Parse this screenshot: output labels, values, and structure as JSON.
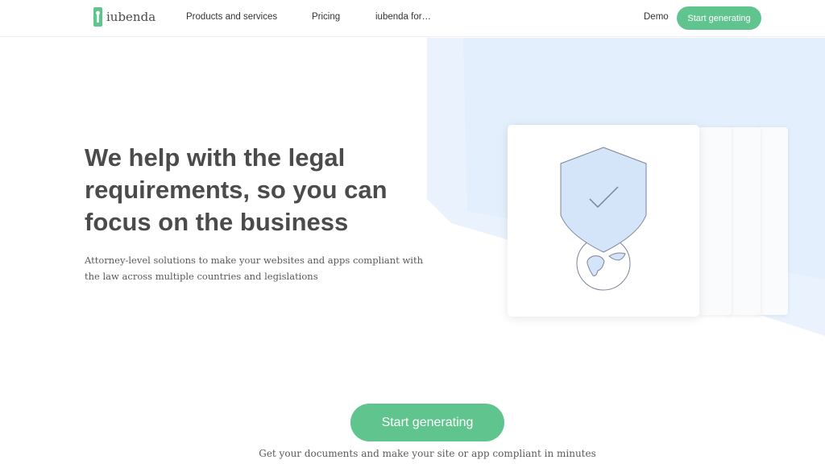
{
  "brand": {
    "name": "iubenda",
    "logo_icon": "keyhole-icon",
    "accent_color": "#5fc48e"
  },
  "nav": {
    "products_label": "Products and services",
    "pricing_label": "Pricing",
    "iubenda_for_label": "iubenda for…",
    "demo_label": "Demo",
    "cta_label": "Start generating"
  },
  "hero": {
    "title": "We help with the legal requirements, so you can focus on the business",
    "subtitle": "Attorney-level solutions to make your websites and apps compliant with the law across multiple countries and legislations",
    "illustration_icon": "shield-check-globe-icon"
  },
  "cta": {
    "label": "Start generating",
    "caption": "Get your documents and make your site or app compliant in minutes"
  }
}
